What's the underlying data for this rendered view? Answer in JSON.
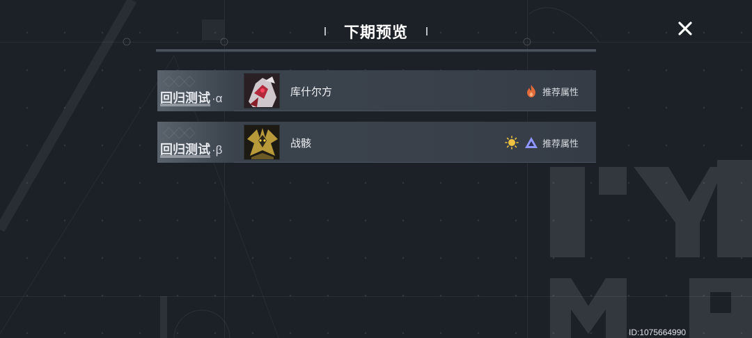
{
  "header": {
    "title": "下期预览",
    "close_icon": "close-x-icon"
  },
  "bosses": [
    {
      "stage_label": "回归测试",
      "stage_greek": "·α",
      "name": "库什尔方",
      "avatar_icon": "boss-mech-red-portrait",
      "elements": [
        "fire-element-icon"
      ],
      "recommend_label": "推荐属性"
    },
    {
      "stage_label": "回归测试",
      "stage_greek": "·β",
      "name": "战骸",
      "avatar_icon": "boss-gold-dragon-portrait",
      "elements": [
        "light-element-icon",
        "void-triangle-element-icon"
      ],
      "recommend_label": "推荐属性"
    }
  ],
  "footer": {
    "player_id": "ID:1075664990"
  },
  "colors": {
    "background": "#1c2128",
    "row": "#3b434d",
    "fire": "#e06a3a",
    "light": "#f0c040",
    "void": "#8f96ff"
  }
}
